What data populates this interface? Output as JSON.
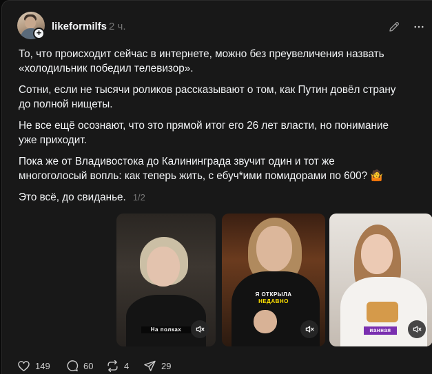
{
  "post": {
    "username": "likeformilfs",
    "time": "2 ч.",
    "paragraphs": [
      "То, что происходит сейчас в интернете, можно без преувеличения назвать «холодильник победил телевизор».",
      "Сотни, если не тысячи роликов рассказывают о том, как Путин довёл страну до полной нищеты.",
      "Не все ещё осознают, что это прямой итог его 26 лет власти, но понимание уже приходит.",
      "Пока же от Владивостока до Калининграда звучит один и тот же многоголосый вопль: как теперь жить, с ебуч*ими помидорами по 600? 🤷"
    ],
    "last_paragraph": "Это всё, до свиданье.",
    "counter": "1/2",
    "media": [
      {
        "caption": "На полках"
      },
      {
        "caption_top": "Я ОТКРЫЛА",
        "caption_bottom": "НЕДАВНО"
      },
      {
        "caption": "ианная"
      }
    ]
  },
  "actions": {
    "likes": "149",
    "replies": "60",
    "reposts": "4",
    "shares": "29"
  },
  "colors": {
    "background": "#181818",
    "text": "#f3f5f7",
    "muted": "#777777",
    "caption_highlight": "#ffe100"
  },
  "icons": {
    "edit": "pencil-icon",
    "more": "more-dots-icon",
    "like": "heart-icon",
    "reply": "comment-icon",
    "repost": "repost-icon",
    "share": "send-icon",
    "mute": "mute-icon"
  }
}
